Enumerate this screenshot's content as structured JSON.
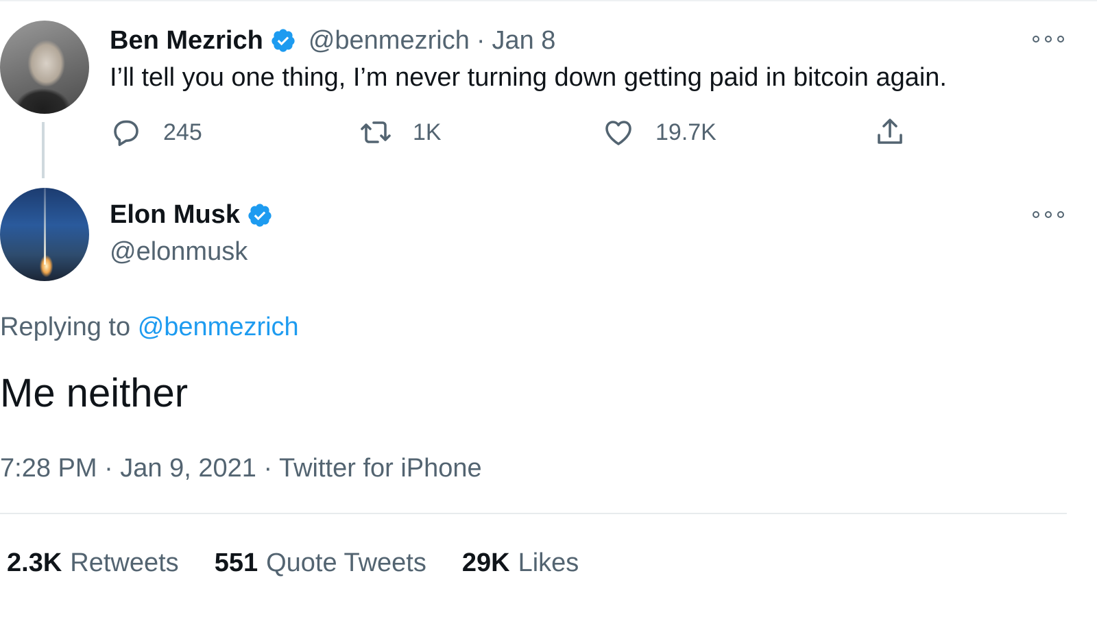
{
  "parent_tweet": {
    "author_name": "Ben Mezrich",
    "author_handle": "@benmezrich",
    "separator": "·",
    "date": "Jan 8",
    "text": "I’ll tell you one thing, I’m never turning down getting paid in bitcoin again.",
    "actions": {
      "replies": "245",
      "retweets": "1K",
      "likes": "19.7K"
    }
  },
  "main_tweet": {
    "author_name": "Elon Musk",
    "author_handle": "@elonmusk",
    "replying_label": "Replying to",
    "replying_handle": "@benmezrich",
    "text": "Me neither",
    "meta": "7:28 PM · Jan 9, 2021 · Twitter for iPhone",
    "stats": [
      {
        "value": "2.3K",
        "label": "Retweets"
      },
      {
        "value": "551",
        "label": "Quote Tweets"
      },
      {
        "value": "29K",
        "label": "Likes"
      }
    ]
  },
  "icons": {
    "verified": "verified-badge-icon",
    "more": "more-options-icon",
    "reply": "reply-icon",
    "retweet": "retweet-icon",
    "like": "heart-icon",
    "share": "share-icon"
  },
  "colors": {
    "text": "#0f1419",
    "muted": "#536471",
    "accent": "#1d9bf0"
  }
}
